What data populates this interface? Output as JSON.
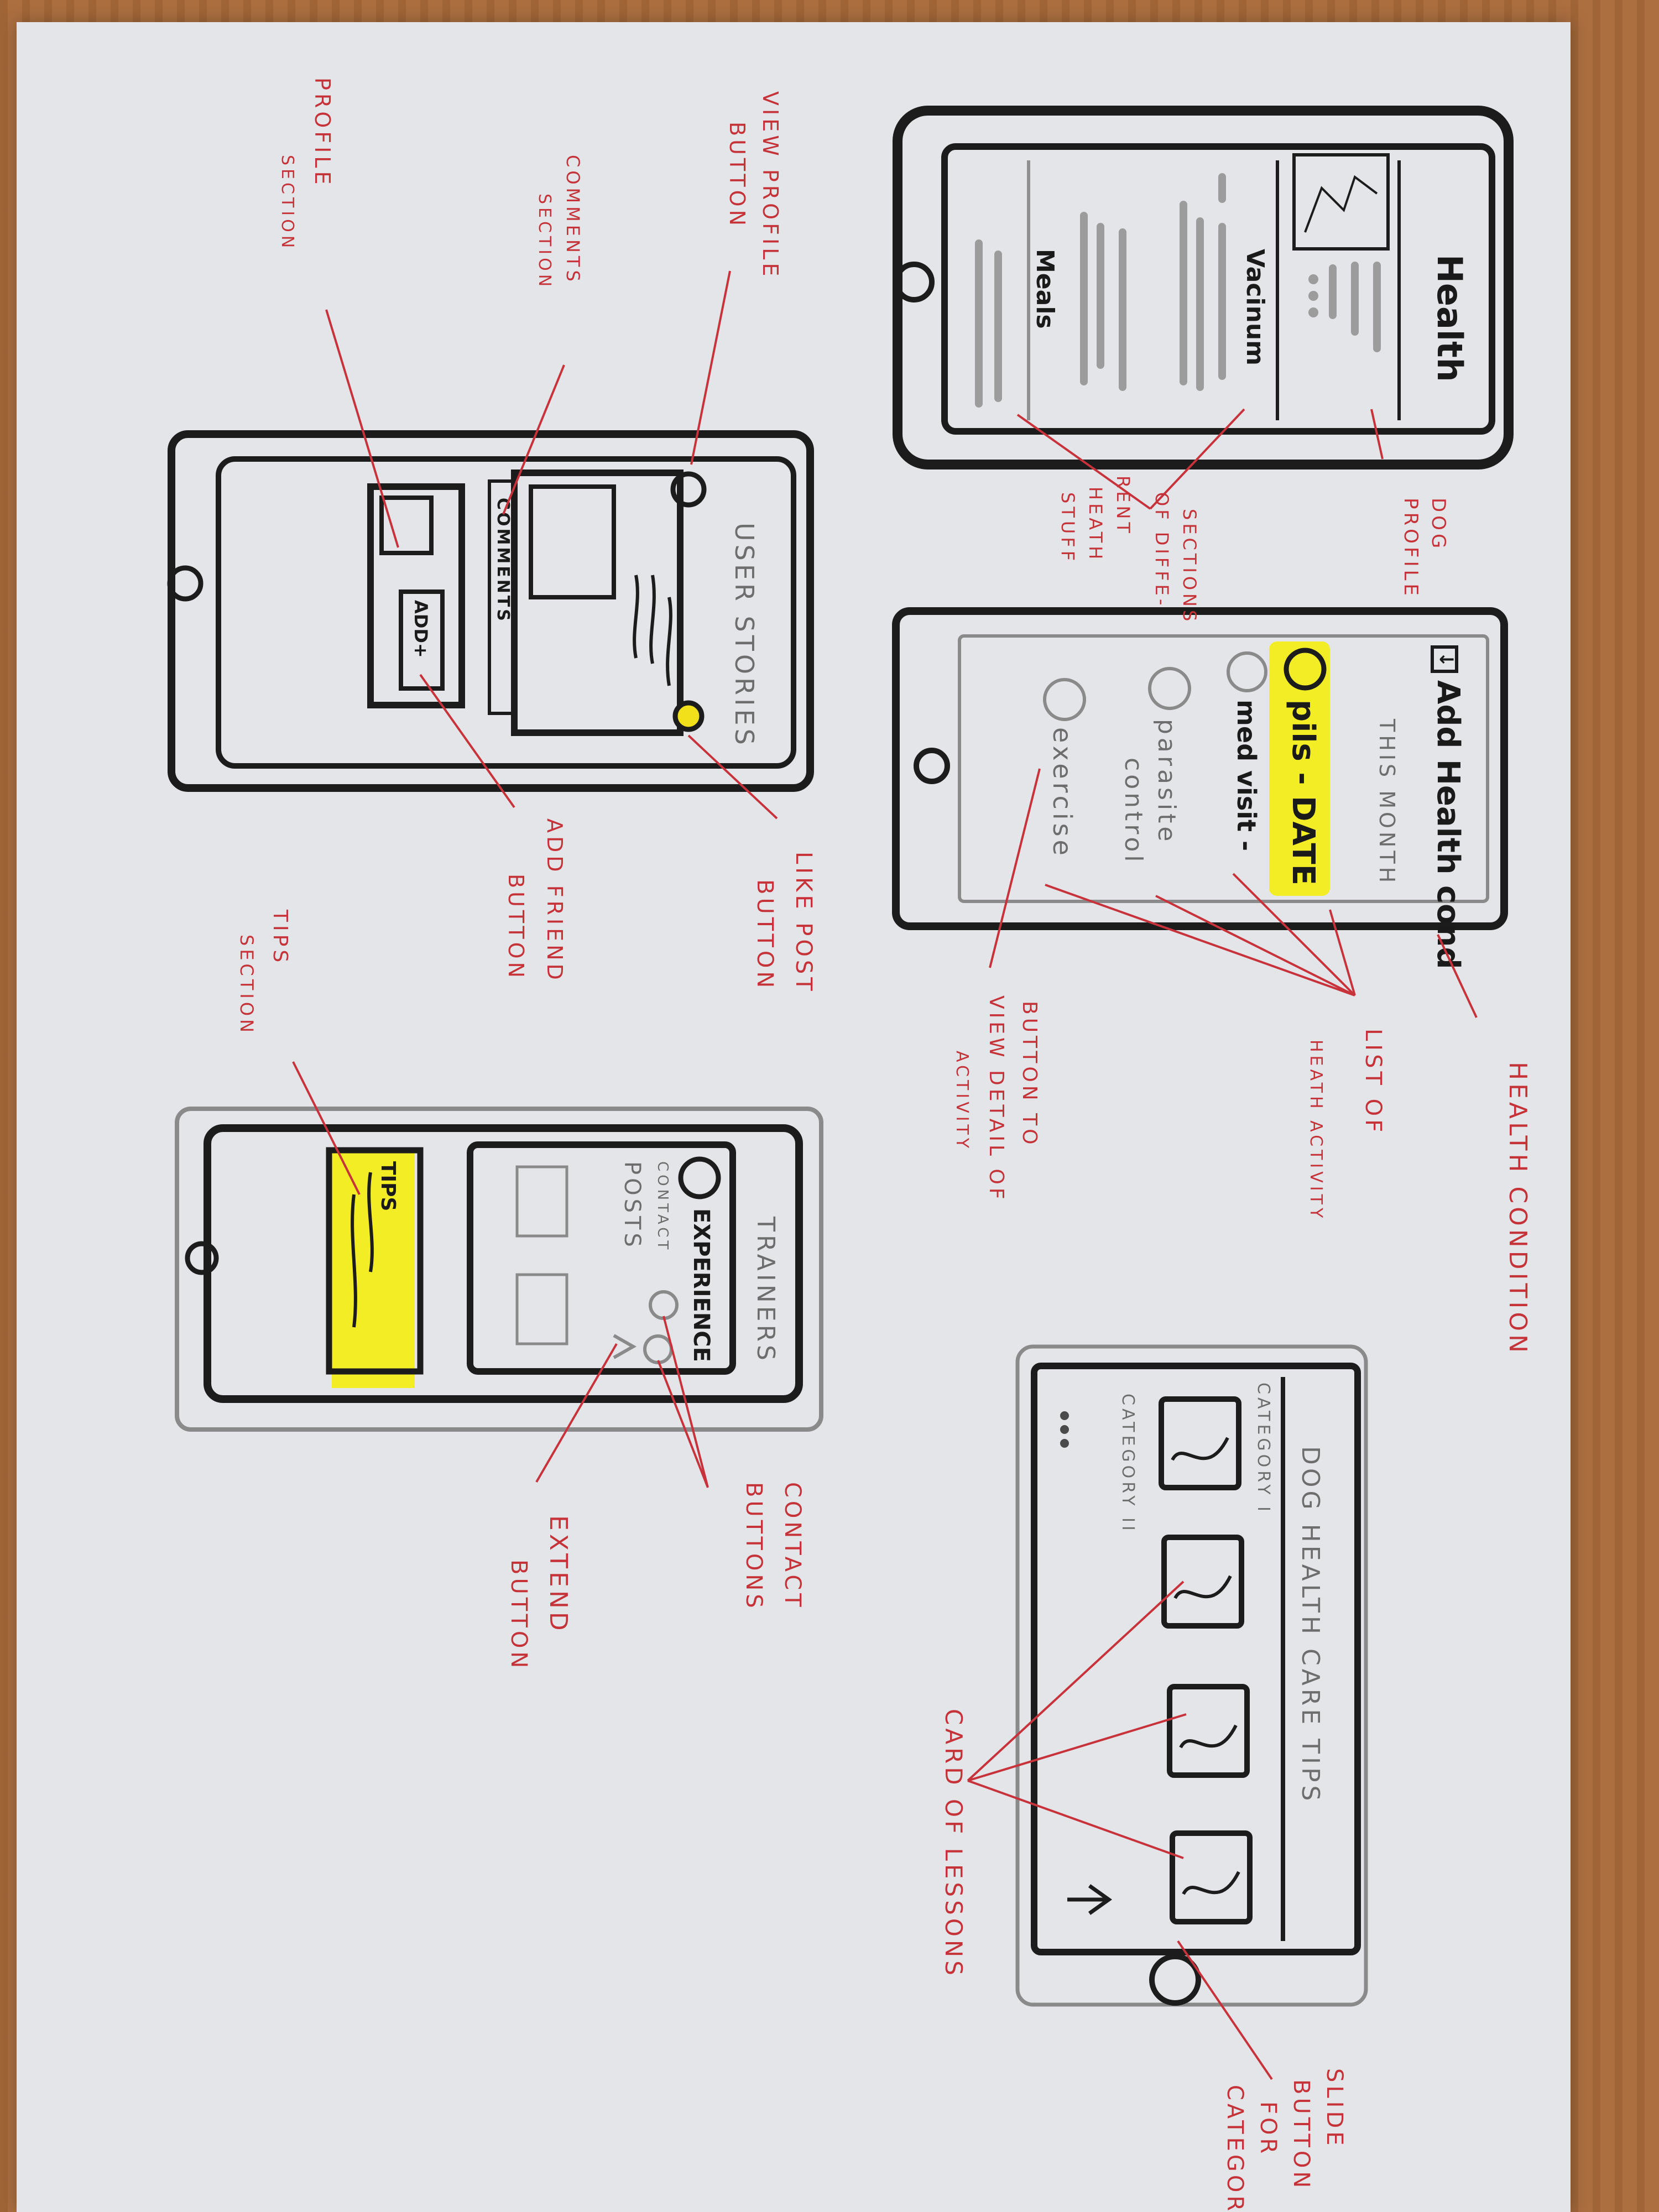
{
  "screens": {
    "dog_profile": {
      "title": "Health",
      "tab_vaccinum": "Vacinum",
      "tab_meals": "Meals"
    },
    "add_health": {
      "header": "Add Health cond",
      "subheader": "THIS MONTH",
      "item_pills": "pils - DATE",
      "item_med": "med visit -",
      "item_parasite_1": "parasite",
      "item_parasite_2": "control",
      "item_exercise": "exercise"
    },
    "user_stories": {
      "title": "USER STORIES",
      "comments": "COMMENTS",
      "add": "ADD+"
    },
    "trainers": {
      "title": "TRAINERS",
      "experience": "EXPERIENCE",
      "contact": "CONTACT",
      "posts": "POSTS",
      "tips": "TIPS"
    },
    "health_tips": {
      "title": "DOG HEALTH CARE TIPS",
      "category_1": "CATEGORY I",
      "category_2": "CATEGORY II"
    }
  },
  "annotations": {
    "dog_profile": [
      "DOG",
      "PROFILE"
    ],
    "sections": [
      "SECTIONS",
      "OF DIFFE-",
      "RENT",
      "HEATH",
      "STUFF"
    ],
    "health_condition": "HEALTH CONDITION",
    "list_of": [
      "LIST OF",
      "HEATH ACTIVITY"
    ],
    "button_to": [
      "BUTTON TO",
      "VIEW DETAIL OF",
      "ACTIVITY"
    ],
    "view_profile": [
      "VIEW PROFILE",
      "BUTTON"
    ],
    "comments_section": [
      "COMMENTS",
      "SECTION"
    ],
    "profile_section": [
      "PROFILE",
      "SECTION"
    ],
    "like_post": [
      "LIKE POST",
      "BUTTON"
    ],
    "add_friend": [
      "ADD FRIEND",
      "BUTTON"
    ],
    "tips_section": [
      "TIPS",
      "SECTION"
    ],
    "contact_buttons": [
      "CONTACT",
      "BUTTONS"
    ],
    "extend_button": [
      "EXTEND",
      "BUTTON"
    ],
    "card_of_lessons": "CARD OF LESSONS",
    "slide_button": [
      "SLIDE",
      "BUTTON",
      "FOR",
      "CATEGORIES"
    ]
  },
  "colors": {
    "ink": "#1c1c1c",
    "red_pen": "#c8323a",
    "highlighter": "#f4ee15",
    "paper": "#e3e5e9",
    "table": "#a86a3a"
  }
}
